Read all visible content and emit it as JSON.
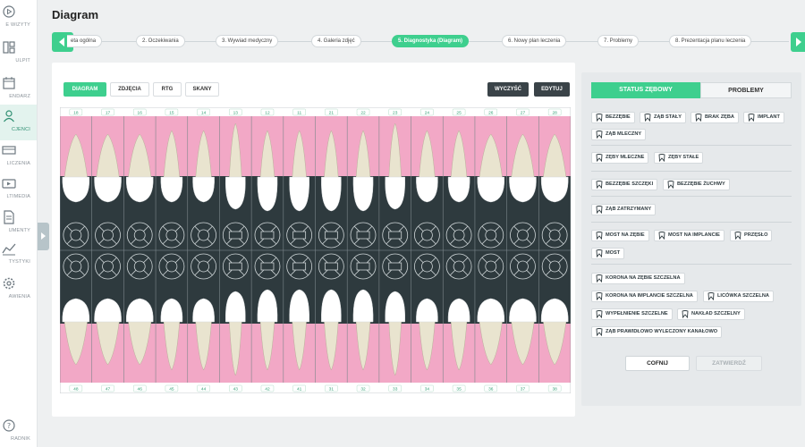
{
  "sidebar": {
    "items": [
      {
        "label": "E WIZYTY",
        "icon": "play-circle-icon"
      },
      {
        "label": "ULPIT",
        "icon": "dashboard-icon"
      },
      {
        "label": "ENDARZ",
        "icon": "calendar-icon"
      },
      {
        "label": "CJENCI",
        "icon": "patient-icon"
      },
      {
        "label": "LICZENIA",
        "icon": "billing-icon"
      },
      {
        "label": "LTIMEDIA",
        "icon": "multimedia-icon"
      },
      {
        "label": "UMENTY",
        "icon": "document-icon"
      },
      {
        "label": "TYSTYKI",
        "icon": "statistics-icon"
      },
      {
        "label": "AWIENIA",
        "icon": "settings-icon"
      },
      {
        "label": "RADNIK",
        "icon": "help-icon"
      }
    ]
  },
  "page": {
    "title": "Diagram"
  },
  "wizard": {
    "steps": [
      "eta ogólna",
      "2. Oczekiwania",
      "3. Wywiad medyczny",
      "4. Galeria zdjęć",
      "5. Diagnostyka (Diagram)",
      "6. Nowy plan leczenia",
      "7. Problemy",
      "8. Prezentacja planu leczenia"
    ],
    "active_index": 4
  },
  "toolbar": {
    "tabs": [
      "DIAGRAM",
      "ZDJĘCIA",
      "RTG",
      "SKANY"
    ],
    "active_tab": "DIAGRAM",
    "clear_label": "WYCZYŚĆ",
    "edit_label": "EDYTUJ"
  },
  "chart_data": {
    "type": "dental-diagram",
    "upper_teeth": [
      "18",
      "17",
      "16",
      "15",
      "14",
      "13",
      "12",
      "11",
      "21",
      "22",
      "23",
      "24",
      "25",
      "26",
      "27",
      "28"
    ],
    "lower_teeth": [
      "48",
      "47",
      "46",
      "45",
      "44",
      "43",
      "42",
      "41",
      "31",
      "32",
      "33",
      "34",
      "35",
      "36",
      "37",
      "38"
    ],
    "colors": {
      "gum": "#f2a8c6",
      "background": "#2e3a3e",
      "root": "#e9e4cf",
      "crown": "#ffffff",
      "number": "#2f9e73"
    }
  },
  "status_panel": {
    "tabs": [
      "STATUS ZĘBOWY",
      "PROBLEMY"
    ],
    "active_tab": "STATUS ZĘBOWY",
    "groups": [
      [
        "BEZZĘBIE",
        "ZĄB STAŁY",
        "BRAK ZĘBA",
        "IMPLANT",
        "ZĄB MLECZNY"
      ],
      [
        "ZĘBY MLECZNE",
        "ZĘBY STAŁE"
      ],
      [
        "BEZZĘBIE SZCZĘKI",
        "BEZZĘBIE ŻUCHWY"
      ],
      [
        "ZĄB ZATRZYMANY"
      ],
      [
        "MOST NA ZĘBIE",
        "MOST NA IMPLANCIE",
        "PRZĘSŁO",
        "MOST"
      ],
      [
        "KORONA NA ZĘBIE SZCZELNA",
        "KORONA NA IMPLANCIE SZCZELNA",
        "LICÓWKA SZCZELNA",
        "WYPEŁNIENIE SZCZELNE",
        "NAKŁAD SZCZELNY",
        "ZĄB PRAWIDŁOWO WYLECZONY KANAŁOWO"
      ]
    ],
    "undo_label": "COFNIJ",
    "confirm_label": "ZATWIERDŹ"
  },
  "colors": {
    "accent": "#3ecf8e",
    "dark": "#3a4348"
  }
}
